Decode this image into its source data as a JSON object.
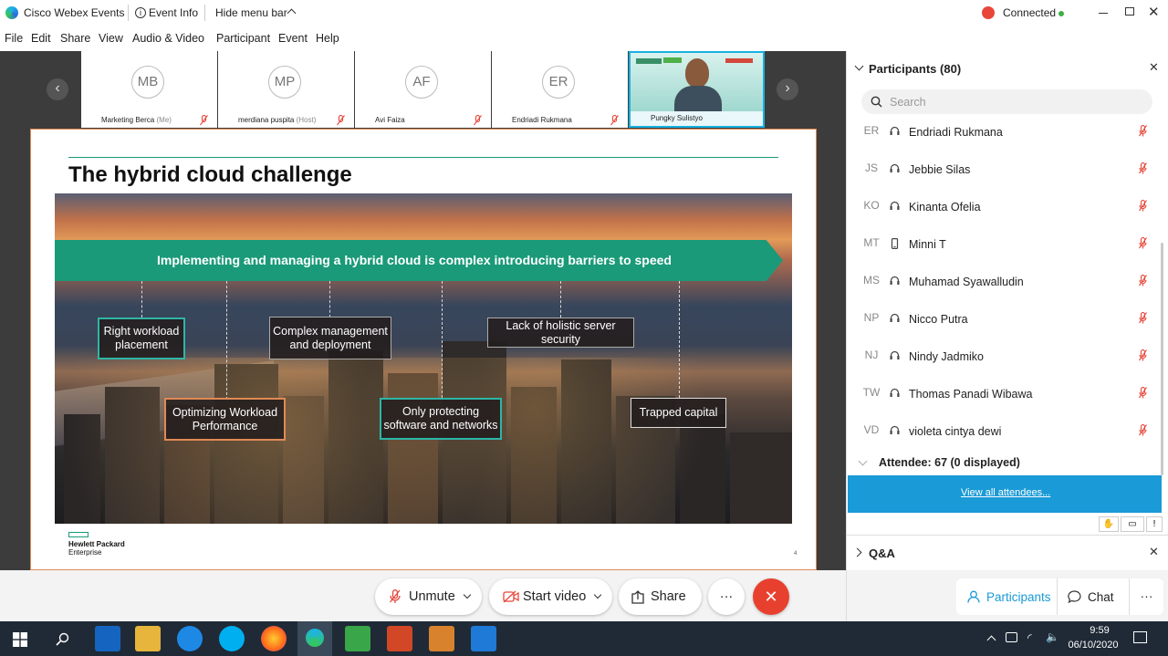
{
  "titlebar": {
    "app_name": "Cisco Webex Events",
    "event_info": "Event Info",
    "hide_menu": "Hide menu bar",
    "connected": "Connected",
    "recording_dot_color": "#e8463a",
    "connected_dot_color": "#3cb043"
  },
  "menu": [
    "File",
    "Edit",
    "Share",
    "View",
    "Audio & Video",
    "Participant",
    "Event",
    "Help"
  ],
  "thumbnails": [
    {
      "initials": "MB",
      "name": "Marketing Berca",
      "suffix": "(Me)"
    },
    {
      "initials": "MP",
      "name": "merdiana puspita",
      "suffix": "(Host)"
    },
    {
      "initials": "AF",
      "name": "Avi Faiza",
      "suffix": ""
    },
    {
      "initials": "ER",
      "name": "Endriadi Rukmana",
      "suffix": ""
    },
    {
      "initials": "",
      "name": "Pungky Sulistyo",
      "suffix": ""
    }
  ],
  "slide": {
    "title": "The hybrid cloud challenge",
    "banner": "Implementing and managing a hybrid cloud is complex introducing barriers to speed",
    "boxes": [
      "Right workload placement",
      "Complex management and deployment",
      "Lack of holistic server security",
      "Optimizing Workload Performance",
      "Only protecting software and networks",
      "Trapped capital"
    ],
    "logo_line1": "Hewlett Packard",
    "logo_line2": "Enterprise",
    "page_number": "4",
    "banner_color": "#1a9a78"
  },
  "controls": {
    "unmute": "Unmute",
    "start_video": "Start video",
    "share": "Share",
    "more": "···",
    "end_color": "#e8402f"
  },
  "panel": {
    "participants_header": "Participants (80)",
    "search_placeholder": "Search",
    "participants": [
      {
        "initials": "ER",
        "name": "Endriadi Rukmana",
        "device": "headset-icon"
      },
      {
        "initials": "JS",
        "name": "Jebbie Silas",
        "device": "headset-icon"
      },
      {
        "initials": "KO",
        "name": "Kinanta Ofelia",
        "device": "headset-icon"
      },
      {
        "initials": "MT",
        "name": "Minni T",
        "device": "phone-icon"
      },
      {
        "initials": "MS",
        "name": "Muhamad Syawalludin",
        "device": "headset-icon"
      },
      {
        "initials": "NP",
        "name": "Nicco Putra",
        "device": "headset-icon"
      },
      {
        "initials": "NJ",
        "name": "Nindy Jadmiko",
        "device": "headset-icon"
      },
      {
        "initials": "TW",
        "name": "Thomas Panadi Wibawa",
        "device": "headset-icon"
      },
      {
        "initials": "VD",
        "name": "violeta cintya dewi",
        "device": "headset-icon"
      }
    ],
    "attendee_label": "Attendee: 67 (0 displayed)",
    "view_all": "View all attendees...",
    "qa_label": "Q&A",
    "participants_btn": "Participants",
    "chat_btn": "Chat",
    "more_btn": "···",
    "accent_color": "#1a9ad6"
  },
  "taskbar": {
    "time": "9:59",
    "date": "06/10/2020"
  }
}
